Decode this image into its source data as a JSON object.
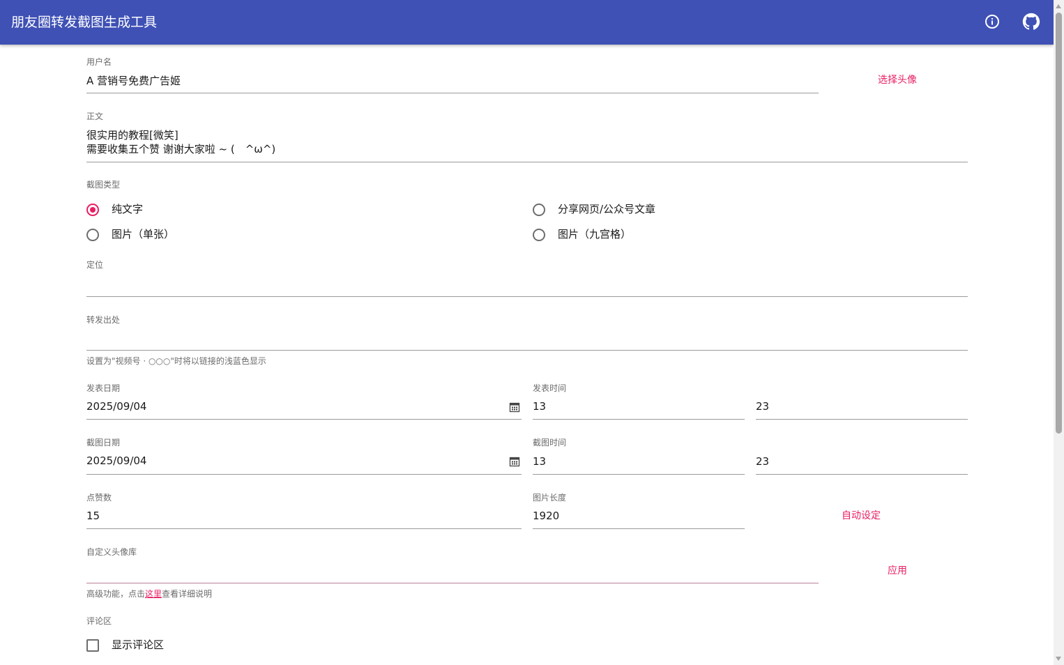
{
  "appbar": {
    "title": "朋友圈转发截图生成工具",
    "info_icon": "info-icon",
    "github_icon": "github-icon",
    "color": "#3f51b5"
  },
  "accent_color": "#e91e63",
  "form": {
    "username": {
      "label": "用户名",
      "value": "A 营销号免费广告姬"
    },
    "choose_avatar": "选择头像",
    "content": {
      "label": "正文",
      "line1": "很实用的教程[微笑]",
      "line2": "需要收集五个赞 谢谢大家啦 ~ (　^ω^)"
    },
    "screenshot_type": {
      "label": "截图类型",
      "options": [
        "纯文字",
        "分享网页/公众号文章",
        "图片（单张）",
        "图片（九宫格）"
      ],
      "selected": "纯文字"
    },
    "location": {
      "label": "定位",
      "value": ""
    },
    "forward_source": {
      "label": "转发出处",
      "value": "",
      "helper": "设置为\"视频号 · ○○○\"时将以链接的浅蓝色显示"
    },
    "post_date": {
      "label": "发表日期",
      "value": "2025/09/04"
    },
    "post_time": {
      "label": "发表时间",
      "hour": "13",
      "minute": "23"
    },
    "shot_date": {
      "label": "截图日期",
      "value": "2025/09/04"
    },
    "shot_time": {
      "label": "截图时间",
      "hour": "13",
      "minute": "23"
    },
    "likes": {
      "label": "点赞数",
      "value": "15"
    },
    "image_length": {
      "label": "图片长度",
      "value": "1920"
    },
    "auto_set": "自动设定",
    "avatar_lib": {
      "label": "自定义头像库",
      "value": "",
      "helper_prefix": "高级功能，点击",
      "helper_link": "这里",
      "helper_suffix": "查看详细说明"
    },
    "apply": "应用",
    "comments": {
      "label": "评论区",
      "checkbox_label": "显示评论区",
      "checked": false
    }
  }
}
